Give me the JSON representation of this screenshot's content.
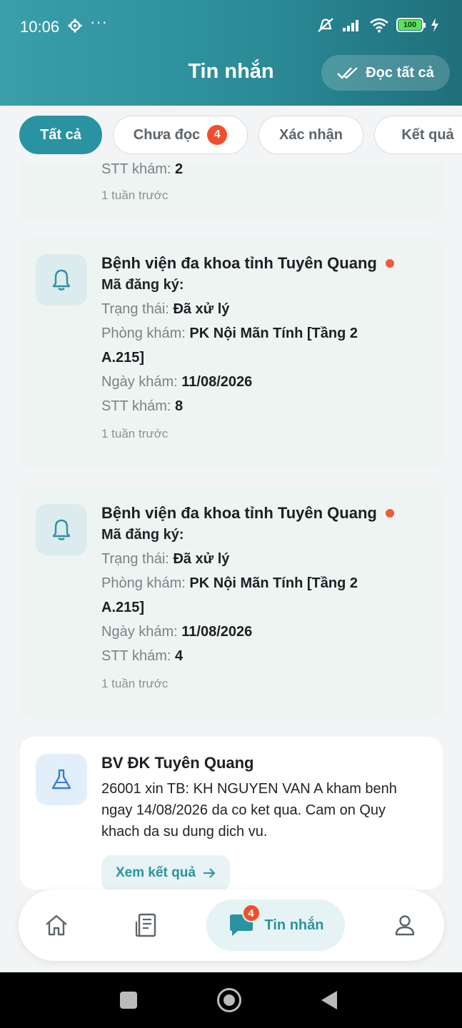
{
  "status_bar": {
    "time": "10:06",
    "battery": "100"
  },
  "header": {
    "title": "Tin nhắn",
    "read_all_label": "Đọc tất cả"
  },
  "tabs": [
    {
      "label": "Tất cả",
      "active": true
    },
    {
      "label": "Chưa đọc",
      "badge": "4"
    },
    {
      "label": "Xác nhận"
    },
    {
      "label": "Kết quả"
    }
  ],
  "partial_card": {
    "stt_label": "STT khám:",
    "stt_value": "2",
    "time_ago": "1 tuần trước"
  },
  "notifications": [
    {
      "title": "Bệnh viện đa khoa tỉnh Tuyên Quang",
      "code_label": "Mã đăng ký:",
      "status_label": "Trạng thái:",
      "status_value": "Đã xử lý",
      "room_label": "Phòng khám:",
      "room_value": "PK Nội Mãn Tính  [Tầng 2",
      "room_value_2": "A.215]",
      "date_label": "Ngày khám:",
      "date_value": "11/08/2026",
      "stt_label": "STT khám:",
      "stt_value": "8",
      "time_ago": "1 tuần trước"
    },
    {
      "title": "Bệnh viện đa khoa tỉnh Tuyên Quang",
      "code_label": "Mã đăng ký:",
      "status_label": "Trạng thái:",
      "status_value": "Đã xử lý",
      "room_label": "Phòng khám:",
      "room_value": "PK Nội Mãn Tính  [Tầng 2",
      "room_value_2": "A.215]",
      "date_label": "Ngày khám:",
      "date_value": "11/08/2026",
      "stt_label": "STT khám:",
      "stt_value": "4",
      "time_ago": "1 tuần trước"
    }
  ],
  "result_card": {
    "title": "BV ĐK Tuyên Quang",
    "message": "26001 xin TB: KH NGUYEN VAN A kham benh ngay 14/08/2026 da co ket qua. Cam on Quy khach da su dung dich vu.",
    "button_label": "Xem kết quả"
  },
  "bottom_nav": {
    "messages_label": "Tin nhắn",
    "messages_badge": "4"
  },
  "colors": {
    "primary": "#2a93a1",
    "badge": "#f04f2e",
    "unread_dot": "#f05a3a"
  }
}
